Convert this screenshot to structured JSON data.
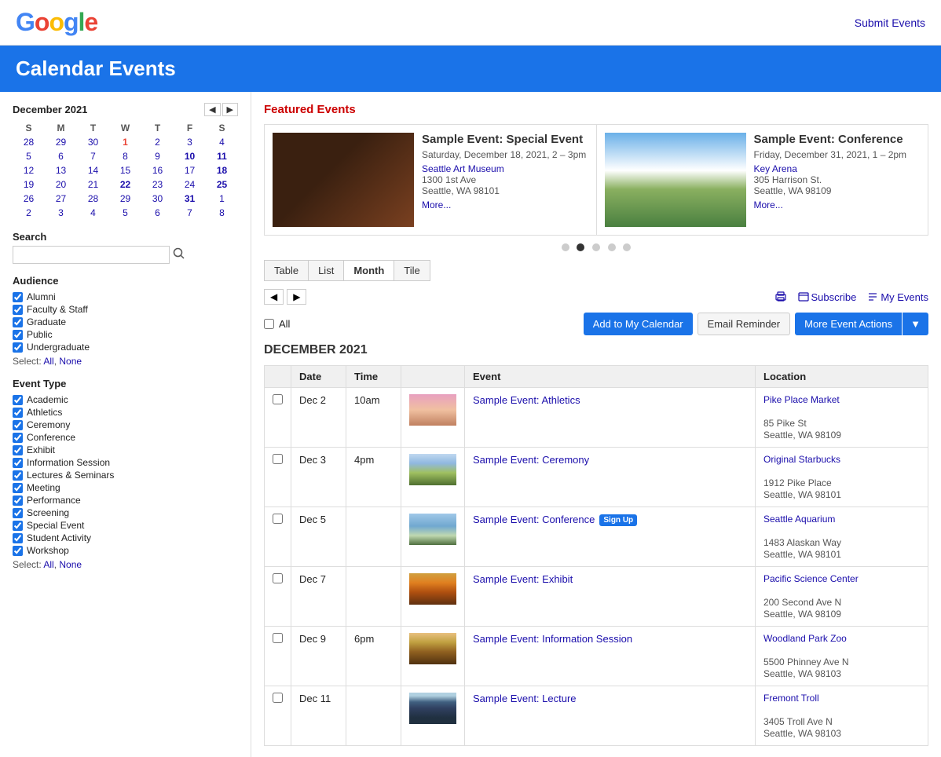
{
  "header": {
    "logo": "Google",
    "submit_link": "Submit Events"
  },
  "banner": {
    "title": "Calendar Events"
  },
  "sidebar": {
    "calendar": {
      "title": "December 2021",
      "days_of_week": [
        "S",
        "M",
        "T",
        "W",
        "T",
        "F",
        "S"
      ],
      "weeks": [
        [
          {
            "label": "28",
            "link": true,
            "other": true
          },
          {
            "label": "29",
            "link": true,
            "other": true
          },
          {
            "label": "30",
            "link": true,
            "other": true,
            "highlight": false
          },
          {
            "label": "1",
            "link": true,
            "today": true
          },
          {
            "label": "2",
            "link": true
          },
          {
            "label": "3",
            "link": true
          },
          {
            "label": "4",
            "link": true
          }
        ],
        [
          {
            "label": "5",
            "link": true
          },
          {
            "label": "6",
            "link": true
          },
          {
            "label": "7",
            "link": true
          },
          {
            "label": "8",
            "link": true
          },
          {
            "label": "9",
            "link": true
          },
          {
            "label": "10",
            "link": true,
            "bold": true
          },
          {
            "label": "11",
            "link": true,
            "bold": true
          }
        ],
        [
          {
            "label": "12",
            "link": true
          },
          {
            "label": "13",
            "link": true
          },
          {
            "label": "14",
            "link": true
          },
          {
            "label": "15",
            "link": true
          },
          {
            "label": "16",
            "link": true
          },
          {
            "label": "17",
            "link": true
          },
          {
            "label": "18",
            "link": true,
            "bold": true
          }
        ],
        [
          {
            "label": "19",
            "link": true
          },
          {
            "label": "20",
            "link": true
          },
          {
            "label": "21",
            "link": true
          },
          {
            "label": "22",
            "link": true,
            "bold": true
          },
          {
            "label": "23",
            "link": true
          },
          {
            "label": "24",
            "link": true
          },
          {
            "label": "25",
            "link": true,
            "bold": true
          }
        ],
        [
          {
            "label": "26",
            "link": true
          },
          {
            "label": "27",
            "link": true
          },
          {
            "label": "28",
            "link": true
          },
          {
            "label": "29",
            "link": true
          },
          {
            "label": "30",
            "link": true
          },
          {
            "label": "31",
            "link": true,
            "bold": true
          },
          {
            "label": "1",
            "link": true,
            "other": true
          }
        ],
        [
          {
            "label": "2",
            "link": true
          },
          {
            "label": "3",
            "link": true
          },
          {
            "label": "4",
            "link": true
          },
          {
            "label": "5",
            "link": true
          },
          {
            "label": "6",
            "link": true
          },
          {
            "label": "7",
            "link": true
          },
          {
            "label": "8",
            "link": true
          }
        ]
      ]
    },
    "search": {
      "label": "Search",
      "placeholder": ""
    },
    "audience": {
      "title": "Audience",
      "items": [
        {
          "label": "Alumni",
          "checked": true
        },
        {
          "label": "Faculty & Staff",
          "checked": true
        },
        {
          "label": "Graduate",
          "checked": true
        },
        {
          "label": "Public",
          "checked": true
        },
        {
          "label": "Undergraduate",
          "checked": true
        }
      ],
      "select_all": "All",
      "select_none": "None"
    },
    "event_type": {
      "title": "Event Type",
      "items": [
        {
          "label": "Academic",
          "checked": true
        },
        {
          "label": "Athletics",
          "checked": true
        },
        {
          "label": "Ceremony",
          "checked": true
        },
        {
          "label": "Conference",
          "checked": true
        },
        {
          "label": "Exhibit",
          "checked": true
        },
        {
          "label": "Information Session",
          "checked": true
        },
        {
          "label": "Lectures & Seminars",
          "checked": true
        },
        {
          "label": "Meeting",
          "checked": true
        },
        {
          "label": "Performance",
          "checked": true
        },
        {
          "label": "Screening",
          "checked": true
        },
        {
          "label": "Special Event",
          "checked": true
        },
        {
          "label": "Student Activity",
          "checked": true
        },
        {
          "label": "Workshop",
          "checked": true
        }
      ],
      "select_all": "All",
      "select_none": "None"
    }
  },
  "featured": {
    "title": "Featured Events",
    "events": [
      {
        "title": "Sample Event: Special Event",
        "date": "Saturday, December 18, 2021, 2 – 3pm",
        "venue": "Seattle Art Museum",
        "address1": "1300 1st Ave",
        "address2": "Seattle, WA 98101",
        "more": "More...",
        "img_class": "img-coffee"
      },
      {
        "title": "Sample Event: Conference",
        "date": "Friday, December 31, 2021, 1 – 2pm",
        "venue": "Key Arena",
        "address1": "305 Harrison St.",
        "address2": "Seattle, WA 98109",
        "more": "More...",
        "img_class": "img-mountains"
      }
    ],
    "dots": [
      1,
      2,
      3,
      4,
      5
    ],
    "active_dot": 1
  },
  "view_tabs": [
    {
      "label": "Table",
      "active": false
    },
    {
      "label": "List",
      "active": false
    },
    {
      "label": "Month",
      "active": false
    },
    {
      "label": "Tile",
      "active": false
    }
  ],
  "controls": {
    "subscribe": "Subscribe",
    "my_events": "My Events",
    "print_title": "Print",
    "all_label": "All",
    "add_to_cal": "Add to My Calendar",
    "email_reminder": "Email Reminder",
    "more_event_actions": "More Event Actions"
  },
  "events_section": {
    "month_label": "DECEMBER 2021",
    "columns": [
      "Date",
      "Time",
      "Event",
      "Location"
    ],
    "rows": [
      {
        "date": "Dec 2",
        "time": "10am",
        "event_title": "Sample Event: Athletics",
        "signup": false,
        "img_class": "img-flowers",
        "venue": "Pike Place Market",
        "address1": "85 Pike St",
        "address2": "Seattle, WA 98109"
      },
      {
        "date": "Dec 3",
        "time": "4pm",
        "event_title": "Sample Event: Ceremony",
        "signup": false,
        "img_class": "img-landscape",
        "venue": "Original Starbucks",
        "address1": "1912 Pike Place",
        "address2": "Seattle, WA 98101"
      },
      {
        "date": "Dec 5",
        "time": "",
        "event_title": "Sample Event: Conference",
        "signup": true,
        "signup_label": "Sign Up",
        "img_class": "img-water",
        "venue": "Seattle Aquarium",
        "address1": "1483 Alaskan Way",
        "address2": "Seattle, WA 98101"
      },
      {
        "date": "Dec 7",
        "time": "",
        "event_title": "Sample Event: Exhibit",
        "signup": false,
        "img_class": "img-autumn",
        "venue": "Pacific Science Center",
        "address1": "200 Second Ave N",
        "address2": "Seattle, WA 98109"
      },
      {
        "date": "Dec 9",
        "time": "6pm",
        "event_title": "Sample Event: Information Session",
        "signup": false,
        "img_class": "img-trees",
        "venue": "Woodland Park Zoo",
        "address1": "5500 Phinney Ave N",
        "address2": "Seattle, WA 98103"
      },
      {
        "date": "Dec 11",
        "time": "",
        "event_title": "Sample Event: Lecture",
        "signup": false,
        "img_class": "img-forest",
        "venue": "Fremont Troll",
        "address1": "3405 Troll Ave N",
        "address2": "Seattle, WA 98103"
      }
    ]
  }
}
